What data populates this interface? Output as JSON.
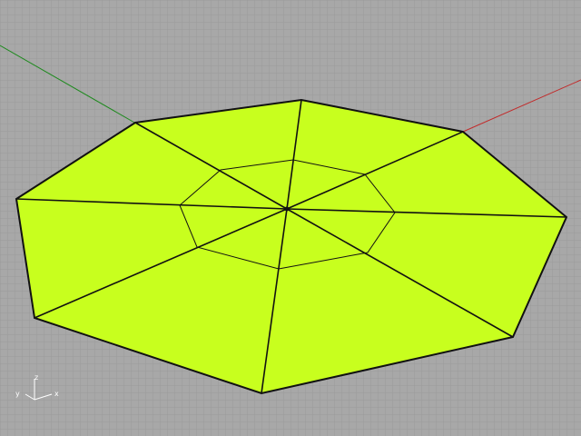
{
  "viewport": {
    "mode": "perspective",
    "background_color": "#a5a5a5",
    "grid_color": "#9a9a9a",
    "grid_visible": true
  },
  "world_axes": {
    "x_axis_color": "#c22a2a",
    "y_axis_color": "#1f8a1f"
  },
  "object": {
    "type": "octagon-surface",
    "fill_color": "#c8ff1e",
    "edge_color": "#111111",
    "outer_sides": 8,
    "inner_ring_sides": 8
  },
  "axis_widget": {
    "x_label": "x",
    "y_label": "y",
    "z_label": "z",
    "color": "#ffffff"
  }
}
